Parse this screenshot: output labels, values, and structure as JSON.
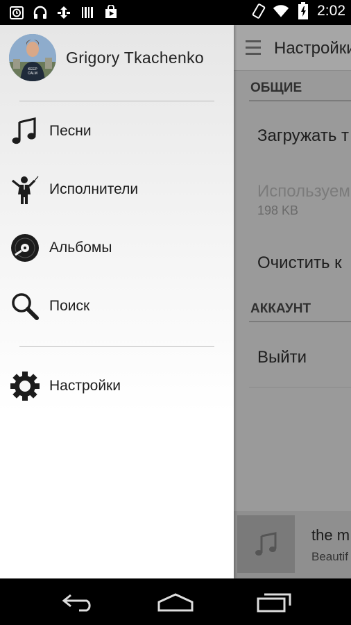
{
  "status_bar": {
    "time": "2:02",
    "left_icons": [
      "alarm-icon",
      "headphones-icon",
      "sync-icon",
      "barcode-icon",
      "play-store-icon"
    ],
    "right_icons": [
      "vibrate-icon",
      "wifi-icon",
      "battery-icon"
    ]
  },
  "drawer": {
    "user_name": "Grigory Tkachenko",
    "items": [
      {
        "label": "Песни",
        "icon": "music-note-icon"
      },
      {
        "label": "Исполнители",
        "icon": "conductor-icon"
      },
      {
        "label": "Альбомы",
        "icon": "vinyl-record-icon"
      },
      {
        "label": "Поиск",
        "icon": "search-icon"
      },
      {
        "label": "Настройки",
        "icon": "gear-icon"
      }
    ]
  },
  "settings_screen": {
    "title": "Настройки",
    "section_general": "ОБЩИЕ",
    "item_download": "Загружать т",
    "item_used": "Используем",
    "item_used_value": "198 KB",
    "item_clear": "Очистить к",
    "section_account": "АККАУНТ",
    "item_logout": "Выйти"
  },
  "mini_player": {
    "track": "the m",
    "artist": "Beautif"
  },
  "nav_bar": {
    "icons": [
      "back-icon",
      "home-icon",
      "recent-apps-icon"
    ]
  }
}
